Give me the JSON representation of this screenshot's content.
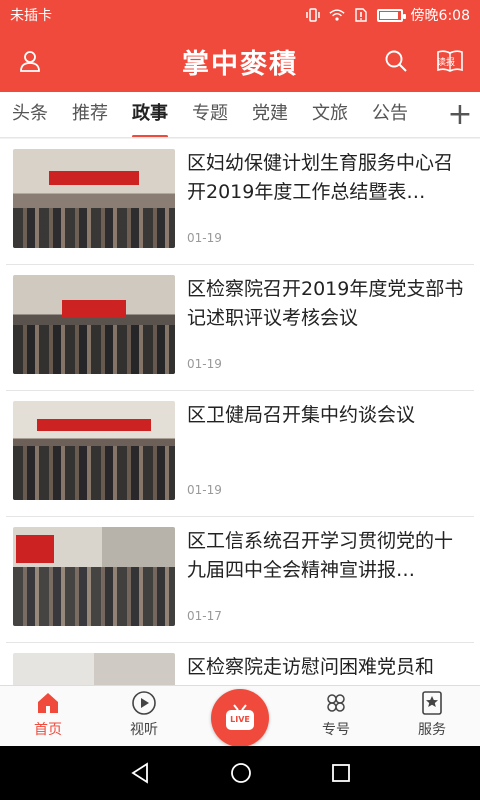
{
  "status_bar": {
    "carrier": "未插卡",
    "time": "傍晚6:08",
    "battery_level": 0.85
  },
  "header": {
    "title": "掌中麥積",
    "read_badge": "读报",
    "icons": [
      "user-icon",
      "search-icon",
      "newspaper-icon"
    ]
  },
  "tabs": [
    {
      "label": "头条",
      "active": false
    },
    {
      "label": "推荐",
      "active": false
    },
    {
      "label": "政事",
      "active": true
    },
    {
      "label": "专题",
      "active": false
    },
    {
      "label": "党建",
      "active": false
    },
    {
      "label": "文旅",
      "active": false
    },
    {
      "label": "公告",
      "active": false
    }
  ],
  "tab_add": "+",
  "news": [
    {
      "title": "区妇幼保健计划生育服务中心召开2019年度工作总结暨表…",
      "date": "01-19"
    },
    {
      "title": "区检察院召开2019年度党支部书记述职评议考核会议",
      "date": "01-19"
    },
    {
      "title": "区卫健局召开集中约谈会议",
      "date": "01-19"
    },
    {
      "title": "区工信系统召开学习贯彻党的十九届四中全会精神宣讲报…",
      "date": "01-17"
    },
    {
      "title": "区检察院走访慰问困难党员和",
      "date": ""
    }
  ],
  "bottom_nav": [
    {
      "label": "首页",
      "icon": "home-icon",
      "active": true
    },
    {
      "label": "视听",
      "icon": "play-icon",
      "active": false
    },
    {
      "label": "",
      "icon": "live-tv-icon",
      "active": false
    },
    {
      "label": "专号",
      "icon": "flower-icon",
      "active": false
    },
    {
      "label": "服务",
      "icon": "star-bookmark-icon",
      "active": false
    }
  ],
  "live_badge": "LIVE",
  "colors": {
    "accent": "#f04a3c",
    "text": "#222222",
    "muted": "#999999"
  }
}
